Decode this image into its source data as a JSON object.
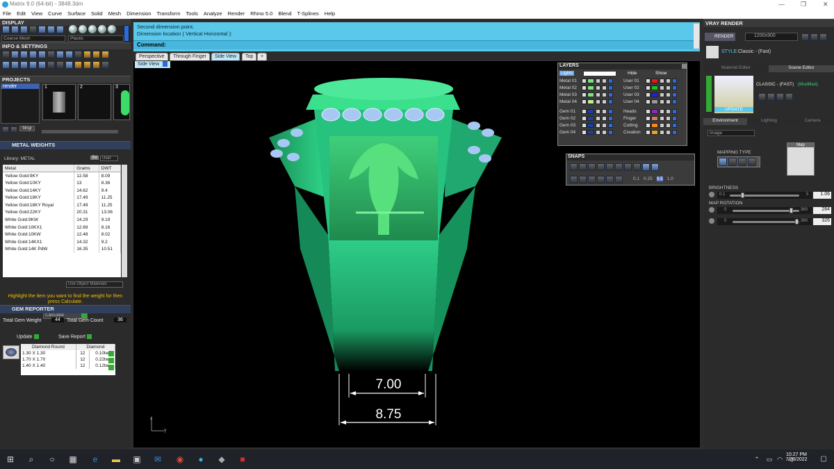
{
  "window": {
    "title": "Matrix 9.0 (64-bit) - 3848.3dm",
    "controls": [
      "—",
      "❐",
      "✕"
    ]
  },
  "menu": [
    "File",
    "Edit",
    "View",
    "Curve",
    "Surface",
    "Solid",
    "Mesh",
    "Dimension",
    "Transform",
    "Tools",
    "Analyze",
    "Render",
    "Rhino 5.0",
    "Blend",
    "T-Splines",
    "Help"
  ],
  "display": {
    "header": "DISPLAY",
    "mesh_select": "Coarse Mesh",
    "mat_select": "Plastic"
  },
  "info": {
    "header": "INFO & SETTINGS"
  },
  "projects": {
    "header": "PROJECTS",
    "items": [
      "render"
    ],
    "thumbs": [
      "1",
      "2",
      "3"
    ],
    "mngr": "Mngr"
  },
  "metal": {
    "header": "METAL WEIGHTS",
    "library": "Library: METAL",
    "sv": "SV",
    "user": "User",
    "columns": [
      "Metal",
      "Grams",
      "DWT"
    ],
    "rows": [
      [
        "Yellow Gold:9KY",
        "12.58",
        "8.09"
      ],
      [
        "Yellow Gold:10KY",
        "13",
        "8.36"
      ],
      [
        "Yellow Gold:14KY",
        "14.62",
        "9.4"
      ],
      [
        "Yellow Gold:18KY",
        "17.49",
        "11.25"
      ],
      [
        "Yellow Gold:18KY Royal",
        "17.49",
        "11.25"
      ],
      [
        "Yellow Gold:22KY",
        "20.31",
        "13.06"
      ],
      [
        "White Gold:9KW",
        "14.29",
        "9.19"
      ],
      [
        "White Gold:10KX1",
        "12.69",
        "8.16"
      ],
      [
        "White Gold:10KW",
        "12.48",
        "8.02"
      ],
      [
        "White Gold:14KX1",
        "14.32",
        "9.2"
      ],
      [
        "White Gold:14K PdW",
        "16.35",
        "10.51"
      ]
    ],
    "use_obj": "Use Object Materials",
    "hint": "Highlight the item you want to find the weight for then press Calculate.",
    "calculate": "Calculate"
  },
  "gem": {
    "header": "GEM REPORTER",
    "total_weight_label": "Total Gem Weight",
    "total_weight": "44",
    "total_count_label": "Total Gem Count",
    "total_count": "36",
    "update": "Update",
    "save": "Save Report",
    "col1": "Diamond Round",
    "col2": "Diamond",
    "rows": [
      [
        "1.30 X 1.30",
        "12",
        "0.10tw"
      ],
      [
        "1.70 X 1.70",
        "12",
        "0.22tw"
      ],
      [
        "1.40 X 1.40",
        "12",
        "0.12tw"
      ]
    ]
  },
  "command": {
    "line1": "Second dimension point.",
    "line2": "Dimension location ( Vertical  Horizontal ):",
    "prompt": "Command:"
  },
  "tabs": [
    "Perspective",
    "Through Finger",
    "Side View",
    "Top",
    "+"
  ],
  "viewport": {
    "label": "Side View",
    "dim1": "7.00",
    "dim2": "8.75",
    "axis_z": "z",
    "axis_y": "y"
  },
  "layers": {
    "header": "LAYERS",
    "lights": "Lights",
    "hide": "Hide",
    "show": "Show",
    "left": [
      "Metal 01",
      "Metal 02",
      "Metal 03",
      "Metal 04",
      "Gem 01",
      "Gem 02",
      "Gem 03",
      "Gem 04"
    ],
    "right": [
      "User 01",
      "User 02",
      "User 03",
      "User 04",
      "Heads",
      "Finger",
      "Cutting",
      "Creation"
    ],
    "left_colors": [
      "#7ee27e",
      "#7ee27e",
      "#7ee27e",
      "#b9ef9a",
      "#1a3fa0",
      "#1a3fa0",
      "#1a3fa0",
      "#1a3fa0"
    ],
    "right_colors": [
      "#e51919",
      "#19c619",
      "#1f22d6",
      "#9a9a9a",
      "#8e2bb0",
      "#d27b6a",
      "#f28a1a",
      "#f0a020"
    ]
  },
  "snaps": {
    "header": "SNAPS",
    "vals": [
      "0.1",
      "0.25",
      "0.5",
      "1.0"
    ]
  },
  "vray": {
    "header": "VRAY RENDER",
    "render": "RENDER",
    "res": "1200x900",
    "style_label": "STYLE:",
    "style": "Classic - (Fast)",
    "tab_mat": "Material Editor",
    "tab_scene": "Scene Editor",
    "preset": "CLASSIC - (FAST)",
    "modified": "(Modified)",
    "update": "UPDATE",
    "subtabs": [
      "Environment",
      "Lighting",
      "Camera"
    ],
    "image_sel": "Image",
    "mapping_type": "MAPPING TYPE",
    "map": "Map",
    "brightness": "BRIGHTNESS",
    "b_min": "0.1",
    "b_max": "5",
    "b_val": "1.06",
    "map_rotation": "MAP ROTATION",
    "r1_min": "0",
    "r1_max": "360",
    "r1_val": "284",
    "r2_min": "0",
    "r2_max": "360",
    "r2_val": "326"
  },
  "taskbar": {
    "time": "10:27 PM",
    "date": "7/28/2022"
  },
  "colors": {
    "accent": "#5ac8ea",
    "ring": "#27c98a",
    "panel": "#2b2b2b"
  }
}
